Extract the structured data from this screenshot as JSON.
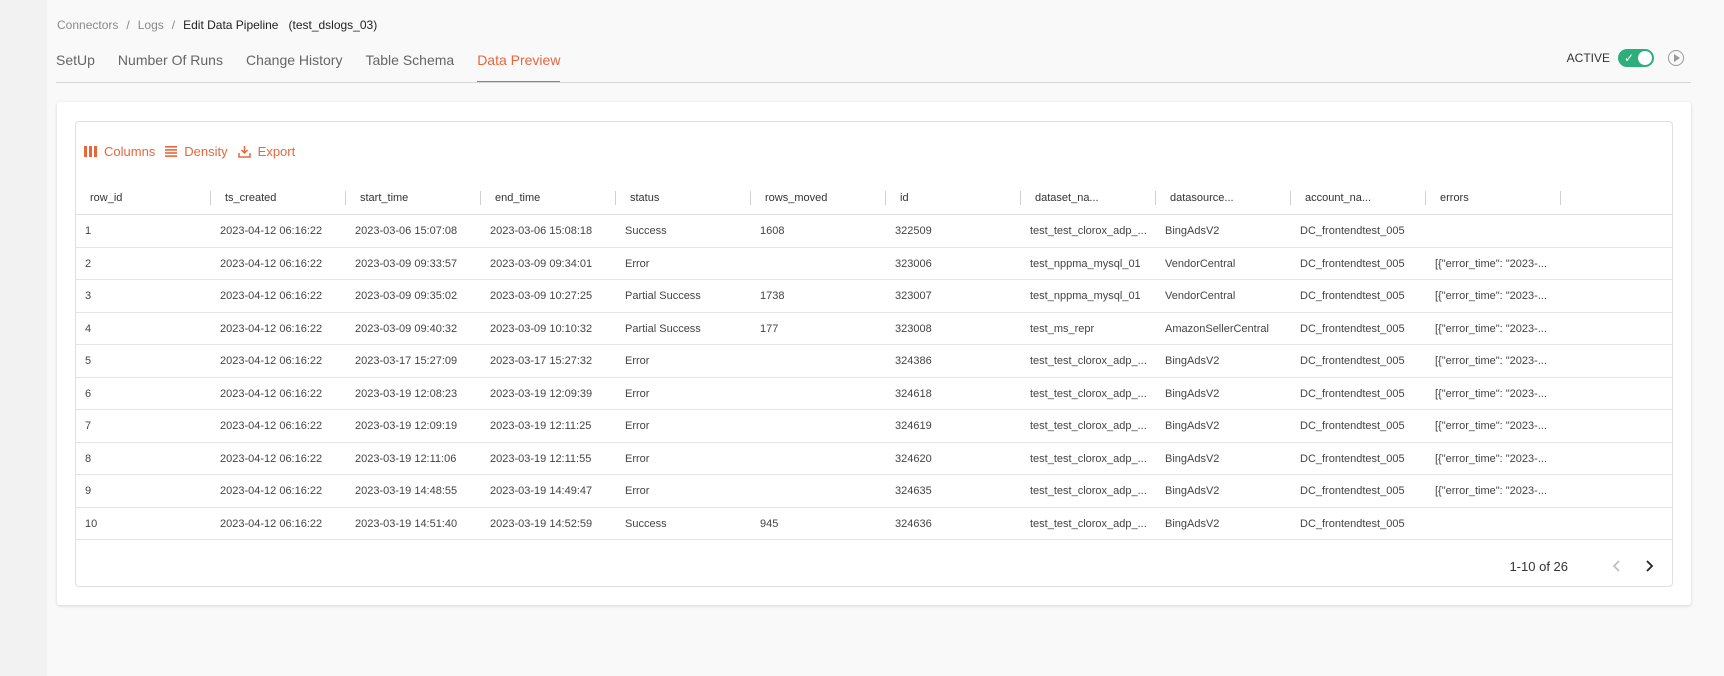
{
  "breadcrumb": {
    "items": [
      "Connectors",
      "Logs"
    ],
    "current": "Edit Data Pipeline",
    "pipeline_name": "(test_dslogs_03)"
  },
  "tabs": [
    {
      "label": "SetUp",
      "active": false
    },
    {
      "label": "Number Of Runs",
      "active": false
    },
    {
      "label": "Change History",
      "active": false
    },
    {
      "label": "Table Schema",
      "active": false
    },
    {
      "label": "Data Preview",
      "active": true
    }
  ],
  "status": {
    "label": "ACTIVE",
    "toggle_on": true,
    "toggle_color": "#2eae7c"
  },
  "accent_color": "#e8663a",
  "toolbar": {
    "columns_label": "Columns",
    "density_label": "Density",
    "export_label": "Export"
  },
  "table": {
    "columns": [
      "row_id",
      "ts_created",
      "start_time",
      "end_time",
      "status",
      "rows_moved",
      "id",
      "dataset_na...",
      "datasource...",
      "account_na...",
      "errors"
    ],
    "rows": [
      [
        "1",
        "2023-04-12 06:16:22",
        "2023-03-06 15:07:08",
        "2023-03-06 15:08:18",
        "Success",
        "1608",
        "322509",
        "test_test_clorox_adp_...",
        "BingAdsV2",
        "DC_frontendtest_005",
        ""
      ],
      [
        "2",
        "2023-04-12 06:16:22",
        "2023-03-09 09:33:57",
        "2023-03-09 09:34:01",
        "Error",
        "",
        "323006",
        "test_nppma_mysql_01",
        "VendorCentral",
        "DC_frontendtest_005",
        "[{\"error_time\": \"2023-..."
      ],
      [
        "3",
        "2023-04-12 06:16:22",
        "2023-03-09 09:35:02",
        "2023-03-09 10:27:25",
        "Partial Success",
        "1738",
        "323007",
        "test_nppma_mysql_01",
        "VendorCentral",
        "DC_frontendtest_005",
        "[{\"error_time\": \"2023-..."
      ],
      [
        "4",
        "2023-04-12 06:16:22",
        "2023-03-09 09:40:32",
        "2023-03-09 10:10:32",
        "Partial Success",
        "177",
        "323008",
        "test_ms_repr",
        "AmazonSellerCentral",
        "DC_frontendtest_005",
        "[{\"error_time\": \"2023-..."
      ],
      [
        "5",
        "2023-04-12 06:16:22",
        "2023-03-17 15:27:09",
        "2023-03-17 15:27:32",
        "Error",
        "",
        "324386",
        "test_test_clorox_adp_...",
        "BingAdsV2",
        "DC_frontendtest_005",
        "[{\"error_time\": \"2023-..."
      ],
      [
        "6",
        "2023-04-12 06:16:22",
        "2023-03-19 12:08:23",
        "2023-03-19 12:09:39",
        "Error",
        "",
        "324618",
        "test_test_clorox_adp_...",
        "BingAdsV2",
        "DC_frontendtest_005",
        "[{\"error_time\": \"2023-..."
      ],
      [
        "7",
        "2023-04-12 06:16:22",
        "2023-03-19 12:09:19",
        "2023-03-19 12:11:25",
        "Error",
        "",
        "324619",
        "test_test_clorox_adp_...",
        "BingAdsV2",
        "DC_frontendtest_005",
        "[{\"error_time\": \"2023-..."
      ],
      [
        "8",
        "2023-04-12 06:16:22",
        "2023-03-19 12:11:06",
        "2023-03-19 12:11:55",
        "Error",
        "",
        "324620",
        "test_test_clorox_adp_...",
        "BingAdsV2",
        "DC_frontendtest_005",
        "[{\"error_time\": \"2023-..."
      ],
      [
        "9",
        "2023-04-12 06:16:22",
        "2023-03-19 14:48:55",
        "2023-03-19 14:49:47",
        "Error",
        "",
        "324635",
        "test_test_clorox_adp_...",
        "BingAdsV2",
        "DC_frontendtest_005",
        "[{\"error_time\": \"2023-..."
      ],
      [
        "10",
        "2023-04-12 06:16:22",
        "2023-03-19 14:51:40",
        "2023-03-19 14:52:59",
        "Success",
        "945",
        "324636",
        "test_test_clorox_adp_...",
        "BingAdsV2",
        "DC_frontendtest_005",
        ""
      ]
    ]
  },
  "pagination": {
    "label": "1-10 of 26"
  }
}
